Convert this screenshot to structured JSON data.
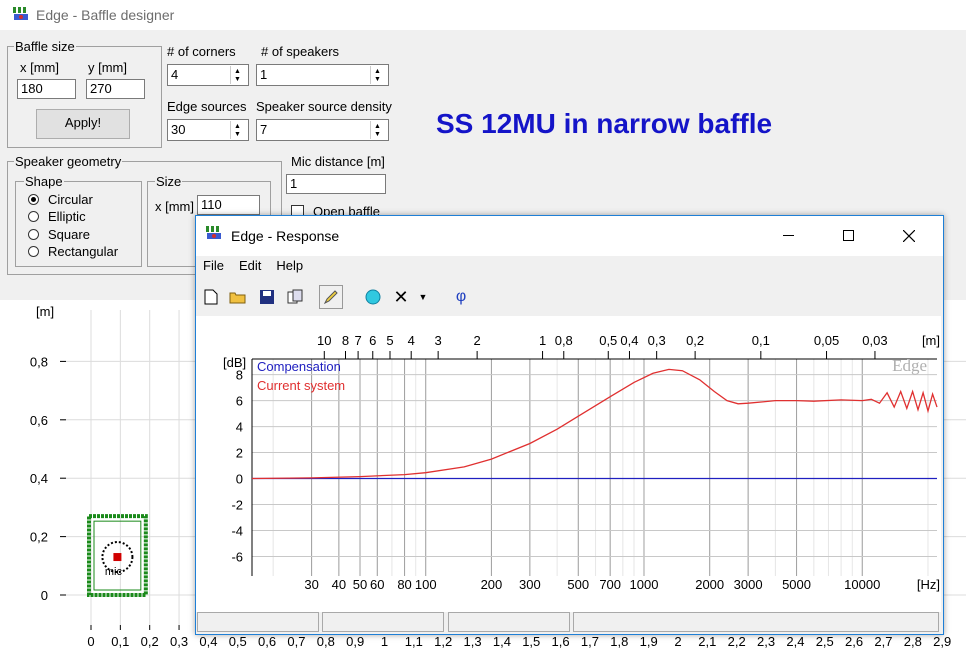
{
  "main_window": {
    "title": "Edge - Baffle designer"
  },
  "baffle_size": {
    "legend": "Baffle size",
    "x_label": "x [mm]",
    "y_label": "y [mm]",
    "x_value": "180",
    "y_value": "270",
    "apply_label": "Apply!"
  },
  "corners": {
    "label": "# of corners",
    "value": "4"
  },
  "speakers": {
    "label": "# of speakers",
    "value": "1"
  },
  "edge_sources": {
    "label": "Edge sources",
    "value": "30"
  },
  "source_density": {
    "label": "Speaker source density",
    "value": "7"
  },
  "heading": "SS 12MU in narrow baffle",
  "speaker_geometry": {
    "legend": "Speaker geometry",
    "shape_legend": "Shape",
    "shapes": [
      "Circular",
      "Elliptic",
      "Square",
      "Rectangular"
    ],
    "selected": "Circular",
    "size_legend": "Size",
    "size_label": "x [mm]",
    "size_value": "110"
  },
  "mic_distance": {
    "label": "Mic distance [m]",
    "value": "1",
    "open_baffle_label": "Open baffle"
  },
  "baffle_plot": {
    "y_unit": "[m]",
    "y_ticks": [
      {
        "label": "0,8",
        "v": 0.8
      },
      {
        "label": "0,6",
        "v": 0.6
      },
      {
        "label": "0,4",
        "v": 0.4
      },
      {
        "label": "0,2",
        "v": 0.2
      },
      {
        "label": "0",
        "v": 0
      }
    ],
    "x_ticks": [
      "0",
      "0,1",
      "0,2",
      "0,3",
      "0,4",
      "0,5",
      "0,6",
      "0,7",
      "0,8",
      "0,9",
      "1",
      "1,1",
      "1,2",
      "1,3",
      "1,4",
      "1,5",
      "1,6",
      "1,7",
      "1,8",
      "1,9",
      "2",
      "2,1",
      "2,2",
      "2,3",
      "2,4",
      "2,5",
      "2,6",
      "2,7",
      "2,8",
      "2,9"
    ],
    "baffle_width_m": 0.18,
    "baffle_height_m": 0.27,
    "mic_label": "mic"
  },
  "response_window": {
    "title": "Edge - Response",
    "menu": [
      "File",
      "Edit",
      "Help"
    ],
    "toolbar": [
      "new-file-icon",
      "open-folder-icon",
      "save-icon",
      "copy-icon",
      "pencil-icon",
      "speaker-icon",
      "delete-x-icon",
      "dropdown-arrow-icon",
      "phi-icon"
    ],
    "phi_glyph": "φ"
  },
  "chart_data": {
    "type": "line",
    "title": "",
    "xlabel": "[Hz]",
    "ylabel": "[dB]",
    "top_axis_label": "[m]",
    "x_scale": "log",
    "xlim": [
      16,
      22000
    ],
    "ylim": [
      -7.5,
      9.2
    ],
    "grid": true,
    "legend_position": "top-left",
    "x_ticks": [
      {
        "label": "30",
        "v": 30
      },
      {
        "label": "40",
        "v": 40
      },
      {
        "label": "50",
        "v": 50
      },
      {
        "label": "60",
        "v": 60
      },
      {
        "label": "80",
        "v": 80
      },
      {
        "label": "100",
        "v": 100
      },
      {
        "label": "200",
        "v": 200
      },
      {
        "label": "300",
        "v": 300
      },
      {
        "label": "500",
        "v": 500
      },
      {
        "label": "700",
        "v": 700
      },
      {
        "label": "1000",
        "v": 1000
      },
      {
        "label": "2000",
        "v": 2000
      },
      {
        "label": "3000",
        "v": 3000
      },
      {
        "label": "5000",
        "v": 5000
      },
      {
        "label": "10000",
        "v": 10000
      }
    ],
    "top_ticks": [
      {
        "label": "10",
        "v": 34.3
      },
      {
        "label": "8",
        "v": 42.9
      },
      {
        "label": "7",
        "v": 49
      },
      {
        "label": "6",
        "v": 57.2
      },
      {
        "label": "5",
        "v": 68.6
      },
      {
        "label": "4",
        "v": 85.8
      },
      {
        "label": "3",
        "v": 114
      },
      {
        "label": "2",
        "v": 172
      },
      {
        "label": "1",
        "v": 343
      },
      {
        "label": "0,8",
        "v": 429
      },
      {
        "label": "0,5",
        "v": 686
      },
      {
        "label": "0,4",
        "v": 858
      },
      {
        "label": "0,3",
        "v": 1143
      },
      {
        "label": "0,2",
        "v": 1715
      },
      {
        "label": "0,1",
        "v": 3430
      },
      {
        "label": "0,05",
        "v": 6860
      },
      {
        "label": "0,03",
        "v": 11433
      }
    ],
    "y_ticks": [
      8,
      6,
      4,
      2,
      0,
      -2,
      -4,
      -6
    ],
    "series": [
      {
        "name": "Compensation",
        "color": "#2020c0",
        "points": [
          [
            16,
            0
          ],
          [
            22000,
            0
          ]
        ]
      },
      {
        "name": "Current system",
        "color": "#e03030",
        "points": [
          [
            16,
            0
          ],
          [
            30,
            0.05
          ],
          [
            50,
            0.15
          ],
          [
            80,
            0.3
          ],
          [
            100,
            0.45
          ],
          [
            150,
            0.9
          ],
          [
            200,
            1.5
          ],
          [
            300,
            2.7
          ],
          [
            400,
            3.8
          ],
          [
            500,
            4.8
          ],
          [
            700,
            6.3
          ],
          [
            900,
            7.4
          ],
          [
            1100,
            8.1
          ],
          [
            1300,
            8.4
          ],
          [
            1500,
            8.3
          ],
          [
            1800,
            7.6
          ],
          [
            2100,
            6.7
          ],
          [
            2400,
            6.0
          ],
          [
            2700,
            5.75
          ],
          [
            3000,
            5.8
          ],
          [
            3500,
            5.9
          ],
          [
            4000,
            6.0
          ],
          [
            5000,
            6.0
          ],
          [
            6000,
            5.95
          ],
          [
            8000,
            6.05
          ],
          [
            10000,
            6.0
          ],
          [
            11000,
            6.1
          ],
          [
            12000,
            5.8
          ],
          [
            13000,
            6.6
          ],
          [
            14000,
            5.5
          ],
          [
            15000,
            6.7
          ],
          [
            16000,
            5.4
          ],
          [
            17000,
            6.7
          ],
          [
            18000,
            5.3
          ],
          [
            19000,
            6.6
          ],
          [
            20000,
            5.2
          ],
          [
            21000,
            6.5
          ],
          [
            22000,
            5.5
          ]
        ]
      }
    ]
  }
}
